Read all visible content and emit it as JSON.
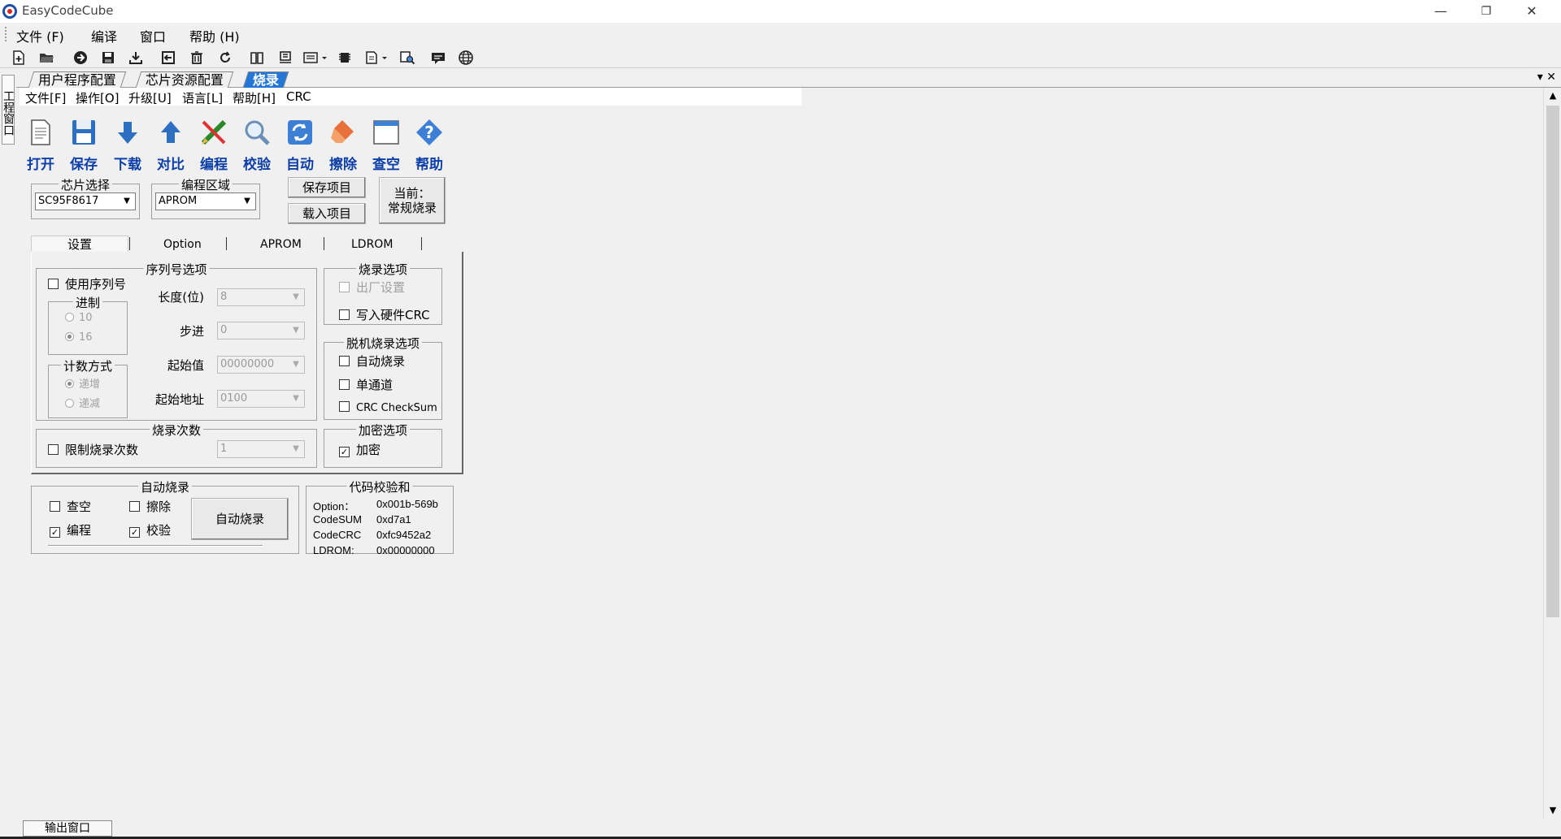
{
  "window": {
    "title": "EasyCodeCube",
    "minimize": "—",
    "restore": "❐",
    "close": "✕"
  },
  "menubar": [
    "文件 (F)",
    "编译",
    "窗口",
    "帮助 (H)"
  ],
  "left_dock": {
    "project_window": "工程窗口"
  },
  "doc_tabs": [
    "用户程序配置",
    "芯片资源配置",
    "烧录"
  ],
  "tabs_right_ctl": "▾ ✕",
  "inner_menu": [
    "文件[F]",
    "操作[O]",
    "升级[U]",
    "语言[L]",
    "帮助[H]",
    "CRC"
  ],
  "big_toolbar": [
    "打开",
    "保存",
    "下载",
    "对比",
    "编程",
    "校验",
    "自动",
    "擦除",
    "查空",
    "帮助"
  ],
  "chip_select": {
    "title": "芯片选择",
    "value": "SC95F8617"
  },
  "prog_area": {
    "title": "编程区域",
    "value": "APROM"
  },
  "buttons": {
    "save_project": "保存项目",
    "load_project": "载入项目",
    "current_line1": "当前：",
    "current_line2": "常规烧录"
  },
  "sub_tabs": [
    "设置",
    "Option",
    "APROM",
    "LDROM"
  ],
  "serial": {
    "title": "序列号选项",
    "use_serial": "使用序列号",
    "radix_title": "进制",
    "radix_10": "10",
    "radix_16": "16",
    "count_title": "计数方式",
    "count_inc": "递增",
    "count_dec": "递减",
    "length_label": "长度(位)",
    "length_value": "8",
    "step_label": "步进",
    "step_value": "0",
    "start_label": "起始值",
    "start_value": "00000000",
    "addr_label": "起始地址",
    "addr_value": "0100"
  },
  "burn_options": {
    "title": "烧录选项",
    "factory": "出厂设置",
    "write_crc": "写入硬件CRC"
  },
  "offline": {
    "title": "脱机烧录选项",
    "auto": "自动烧录",
    "single": "单通道",
    "checksum": "CRC CheckSum"
  },
  "burn_count": {
    "title": "烧录次数",
    "limit": "限制烧录次数",
    "value": "1"
  },
  "encrypt": {
    "title": "加密选项",
    "encrypt": "加密",
    "checked": "✓"
  },
  "auto_burn": {
    "title": "自动烧录",
    "blank": "查空",
    "erase": "擦除",
    "program": "编程",
    "verify": "校验",
    "button": "自动烧录",
    "check": "✓"
  },
  "checksum": {
    "title": "代码校验和",
    "rows": [
      {
        "k": "Option：",
        "v": "0x001b-569b"
      },
      {
        "k": "CodeSUM",
        "v": "0xd7a1"
      },
      {
        "k": "CodeCRC",
        "v": "0xfc9452a2"
      },
      {
        "k": "LDROM:",
        "v": "0x00000000"
      }
    ]
  },
  "output_tab": "输出窗口",
  "colors": {
    "accent": "#2477d6",
    "label_blue": "#0b3ea8"
  }
}
